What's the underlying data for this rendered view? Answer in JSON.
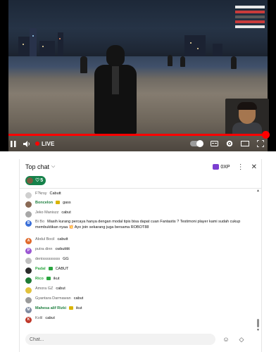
{
  "player": {
    "live_label": "LIVE",
    "progress_fraction": 0.995
  },
  "chat": {
    "title": "Top chat",
    "xp_label": "0XP",
    "viewer_pill": "5",
    "input_placeholder": "Chat...",
    "messages": [
      {
        "author": "F?krsy",
        "text": "Cabutt",
        "avatar_color": "#cfcfcf",
        "type": "normal"
      },
      {
        "author": "Boncelon",
        "text": "gass",
        "avatar_color": "#8a6a55",
        "type": "member",
        "badge": true
      },
      {
        "author": "Jeko Maniszz",
        "text": "cabut",
        "avatar_color": "#a7a7a7",
        "type": "normal"
      },
      {
        "author": "Bi Bo",
        "text": "Masih kurang percaya hanya dengan modal tipis bisa dapat cuan Fantastis ? Testimoni player kami sudah cukup membuktikan nyaa 💥 Ayo join sekarang juga bersama ROBOT88",
        "avatar_color": "#3a6fd8",
        "avatar_letter": "B",
        "type": "normal"
      },
      {
        "author": "Abdul Bocil",
        "text": "cabutt",
        "avatar_color": "#e06a2c",
        "avatar_letter": "A",
        "type": "normal"
      },
      {
        "author": "putra dinn",
        "text": "cwbuttttt",
        "avatar_color": "#9b57d3",
        "avatar_letter": "P",
        "type": "normal"
      },
      {
        "author": "denisssssssss",
        "text": "GG",
        "avatar_color": "#bfbfbf",
        "type": "normal"
      },
      {
        "author": "Padal",
        "text": "CABUT",
        "avatar_color": "#2b2b2b",
        "type": "mod",
        "badge": true
      },
      {
        "author": "Rico",
        "text": "ikut",
        "avatar_color": "#1f7a35",
        "type": "mod",
        "badge": true
      },
      {
        "author": "Amora GZ",
        "text": "cabut",
        "avatar_color": "#e2c23d",
        "type": "normal"
      },
      {
        "author": "Gyantara Darmawan",
        "text": "cabut",
        "avatar_color": "#9a9a9a",
        "type": "normal"
      },
      {
        "author": "Mahesa alif Rizki",
        "text": "ikut",
        "avatar_color": "#7e8aa0",
        "avatar_letter": "M",
        "type": "member",
        "badge": true
      },
      {
        "author": "Kolil",
        "text": "cabut",
        "avatar_color": "#c0392b",
        "avatar_letter": "K",
        "type": "normal"
      }
    ]
  }
}
